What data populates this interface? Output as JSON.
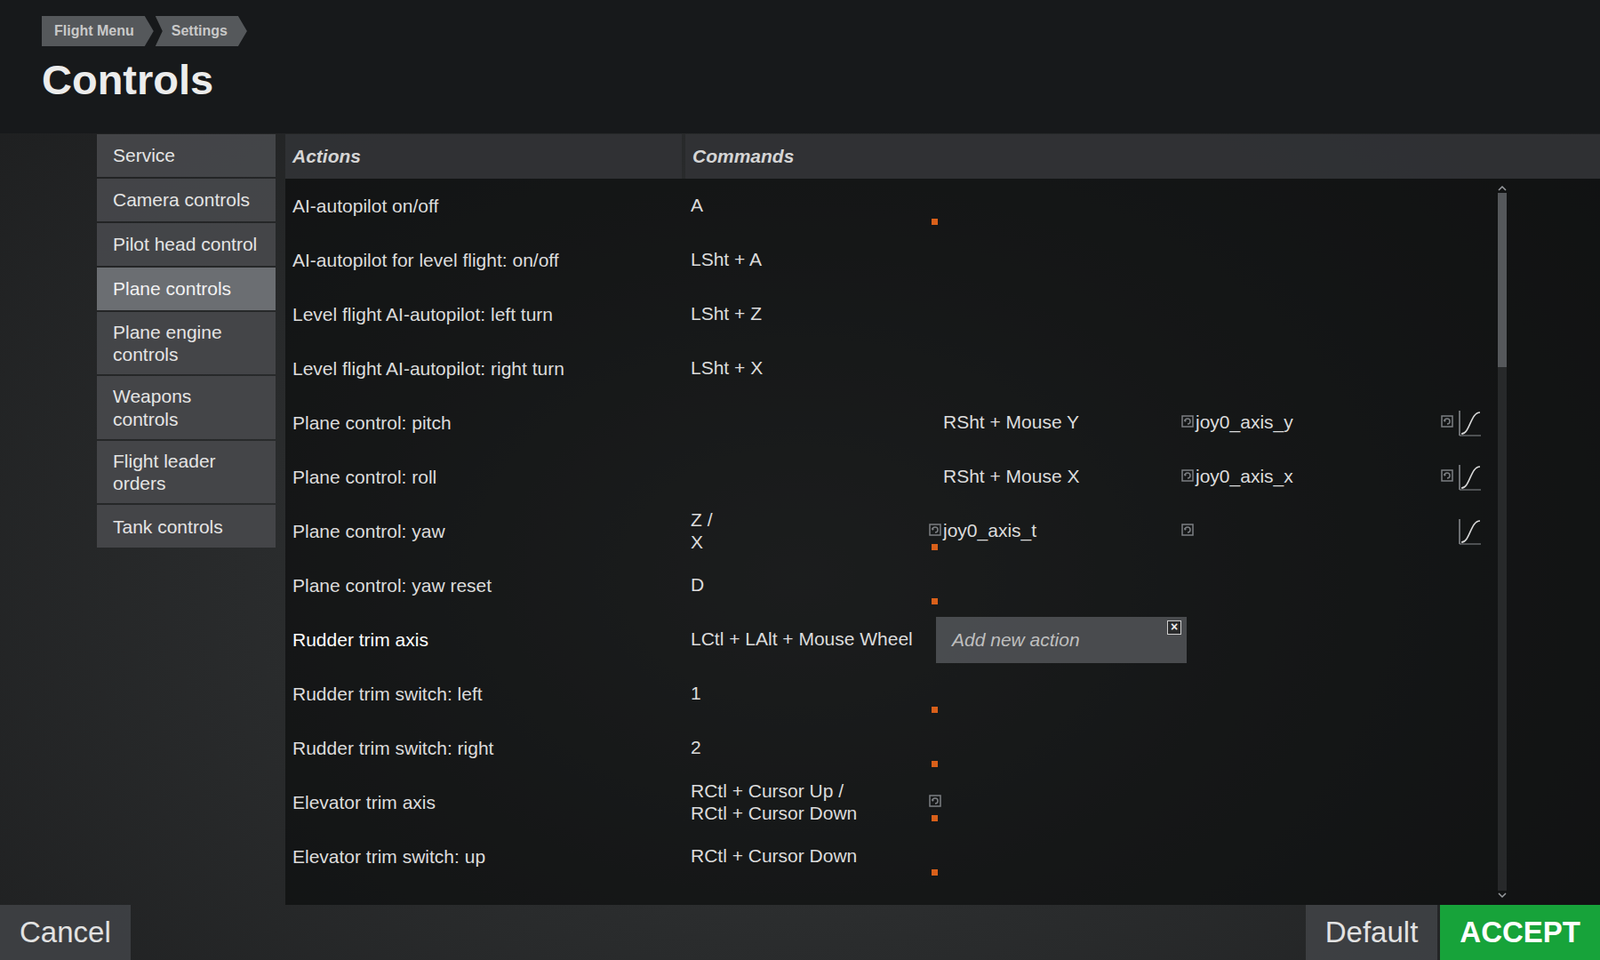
{
  "breadcrumb": [
    {
      "label": "Flight Menu"
    },
    {
      "label": "Settings"
    }
  ],
  "title": "Controls",
  "sidebar": {
    "items": [
      {
        "label": "Service",
        "selected": false
      },
      {
        "label": "Camera controls",
        "selected": false
      },
      {
        "label": "Pilot head control",
        "selected": false
      },
      {
        "label": "Plane controls",
        "selected": true
      },
      {
        "label": "Plane engine controls",
        "selected": false
      },
      {
        "label": "Weapons controls",
        "selected": false
      },
      {
        "label": "Flight leader orders",
        "selected": false
      },
      {
        "label": "Tank controls",
        "selected": false
      }
    ]
  },
  "table": {
    "columns": [
      "Actions",
      "Commands"
    ],
    "rows": [
      {
        "action": "AI-autopilot on/off",
        "selected": false,
        "keys": {
          "lines": [
            "A"
          ],
          "reset": false,
          "flagged": true
        },
        "mouse": {
          "lines": [],
          "reset": false
        },
        "joystick": {
          "lines": [],
          "reset": false
        },
        "curve": false
      },
      {
        "action": "AI-autopilot for level flight: on/off",
        "selected": false,
        "keys": {
          "lines": [
            "LSht + A"
          ],
          "reset": false,
          "flagged": false
        },
        "mouse": {
          "lines": [],
          "reset": false
        },
        "joystick": {
          "lines": [],
          "reset": false
        },
        "curve": false
      },
      {
        "action": "Level flight AI-autopilot: left turn",
        "selected": false,
        "keys": {
          "lines": [
            "LSht + Z"
          ],
          "reset": false,
          "flagged": false
        },
        "mouse": {
          "lines": [],
          "reset": false
        },
        "joystick": {
          "lines": [],
          "reset": false
        },
        "curve": false
      },
      {
        "action": "Level flight AI-autopilot: right turn",
        "selected": false,
        "keys": {
          "lines": [
            "LSht + X"
          ],
          "reset": false,
          "flagged": false
        },
        "mouse": {
          "lines": [],
          "reset": false
        },
        "joystick": {
          "lines": [],
          "reset": false
        },
        "curve": false
      },
      {
        "action": "Plane control: pitch",
        "selected": false,
        "keys": {
          "lines": [],
          "reset": false,
          "flagged": false
        },
        "mouse": {
          "lines": [
            "RSht + Mouse Y"
          ],
          "reset": true
        },
        "joystick": {
          "lines": [
            "joy0_axis_y"
          ],
          "reset": true
        },
        "curve": true
      },
      {
        "action": "Plane control: roll",
        "selected": false,
        "keys": {
          "lines": [],
          "reset": false,
          "flagged": false
        },
        "mouse": {
          "lines": [
            "RSht + Mouse X"
          ],
          "reset": true
        },
        "joystick": {
          "lines": [
            "joy0_axis_x"
          ],
          "reset": true
        },
        "curve": true
      },
      {
        "action": "Plane control: yaw",
        "selected": false,
        "keys": {
          "lines": [
            "Z /",
            "X"
          ],
          "reset": true,
          "flagged": true
        },
        "mouse": {
          "lines": [
            "joy0_axis_t"
          ],
          "reset": true
        },
        "joystick": {
          "lines": [],
          "reset": false
        },
        "curve": true
      },
      {
        "action": "Plane control: yaw reset",
        "selected": false,
        "keys": {
          "lines": [
            "D"
          ],
          "reset": false,
          "flagged": true
        },
        "mouse": {
          "lines": [],
          "reset": false
        },
        "joystick": {
          "lines": [],
          "reset": false
        },
        "curve": false
      },
      {
        "action": "Rudder trim axis",
        "selected": true,
        "keys": {
          "lines": [
            "LCtl + LAlt + Mouse Wheel"
          ],
          "reset": false,
          "flagged": false
        },
        "mouse": {
          "lines": [],
          "reset": false
        },
        "joystick": {
          "lines": [],
          "reset": false
        },
        "curve": false,
        "popup": {
          "text": "Add new action",
          "close": "×"
        }
      },
      {
        "action": "Rudder trim switch: left",
        "selected": false,
        "keys": {
          "lines": [
            "1"
          ],
          "reset": false,
          "flagged": true
        },
        "mouse": {
          "lines": [],
          "reset": false
        },
        "joystick": {
          "lines": [],
          "reset": false
        },
        "curve": false
      },
      {
        "action": "Rudder trim switch: right",
        "selected": false,
        "keys": {
          "lines": [
            "2"
          ],
          "reset": false,
          "flagged": true
        },
        "mouse": {
          "lines": [],
          "reset": false
        },
        "joystick": {
          "lines": [],
          "reset": false
        },
        "curve": false
      },
      {
        "action": "Elevator trim axis",
        "selected": false,
        "keys": {
          "lines": [
            "RCtl + Cursor Up /",
            "RCtl + Cursor Down"
          ],
          "reset": true,
          "flagged": true
        },
        "mouse": {
          "lines": [],
          "reset": false
        },
        "joystick": {
          "lines": [],
          "reset": false
        },
        "curve": false
      },
      {
        "action": "Elevator trim switch: up",
        "selected": false,
        "keys": {
          "lines": [
            "RCtl + Cursor Down"
          ],
          "reset": false,
          "flagged": true
        },
        "mouse": {
          "lines": [],
          "reset": false
        },
        "joystick": {
          "lines": [],
          "reset": false
        },
        "curve": false
      }
    ]
  },
  "scrollbar": {
    "level": 0.25
  },
  "buttons": [
    {
      "label": "Cancel",
      "kind": "plain"
    },
    {
      "label": "Default",
      "kind": "plain"
    },
    {
      "label": "ACCEPT",
      "kind": "primary"
    }
  ]
}
